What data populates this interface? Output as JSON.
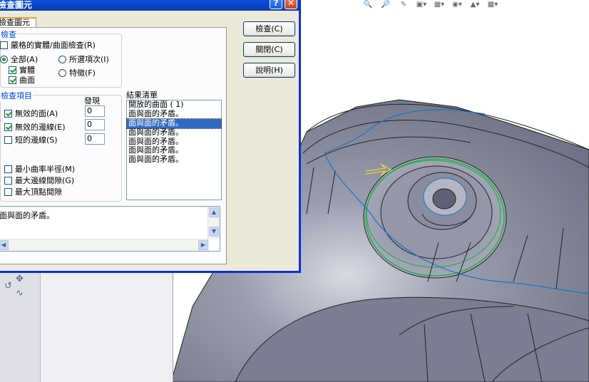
{
  "dialog": {
    "title": "檢查圖元",
    "tab_label": "檢查圖元",
    "help_glyph": "?",
    "close_glyph": "✕",
    "check_group": {
      "title": "檢查",
      "strict_label": "嚴格的實體/曲面檢查(R)",
      "all_label": "全部(A)",
      "selected_label": "所選項次(I)",
      "solid_label": "實體",
      "surface_label": "曲面",
      "feature_label": "特徵(F)"
    },
    "items_group": {
      "title": "檢查項目",
      "found_header": "發現",
      "invalid_face_label": "無效的面(A)",
      "invalid_face_count": "0",
      "invalid_edge_label": "無效的邊線(E)",
      "invalid_edge_count": "0",
      "short_edge_label": "短的邊線(S)",
      "short_edge_count": "0",
      "min_radius_label": "最小曲率半徑(M)",
      "max_edge_gap_label": "最大邊線間隙(G)",
      "max_vertex_gap_label": "最大頂點間隙"
    },
    "results": {
      "header": "結果清單",
      "items": [
        "開放的曲面 ( 1)",
        "面與面的矛盾。",
        "面與面的矛盾。",
        "面與面的矛盾。",
        "面與面的矛盾。",
        "面與面的矛盾。",
        "面與面的矛盾。"
      ],
      "selected_index": 2
    },
    "description": "面與面的矛盾。",
    "buttons": {
      "check": "檢查(C)",
      "close": "關閉(C)",
      "help": "說明(H)"
    }
  },
  "toolbar_icons": [
    "zoom-icon",
    "zoom-to-fit-icon",
    "pan-icon",
    "view-orientation-icon",
    "display-style-icon",
    "hide-show-icon",
    "edit-appearance-icon",
    "scene-icon"
  ],
  "colors": {
    "titlebar": "#0a5fe8",
    "model": "#8e91a3",
    "selected_row": "#316ac5",
    "highlight_green": "#22b14c",
    "edge_blue": "#1e73c8"
  }
}
